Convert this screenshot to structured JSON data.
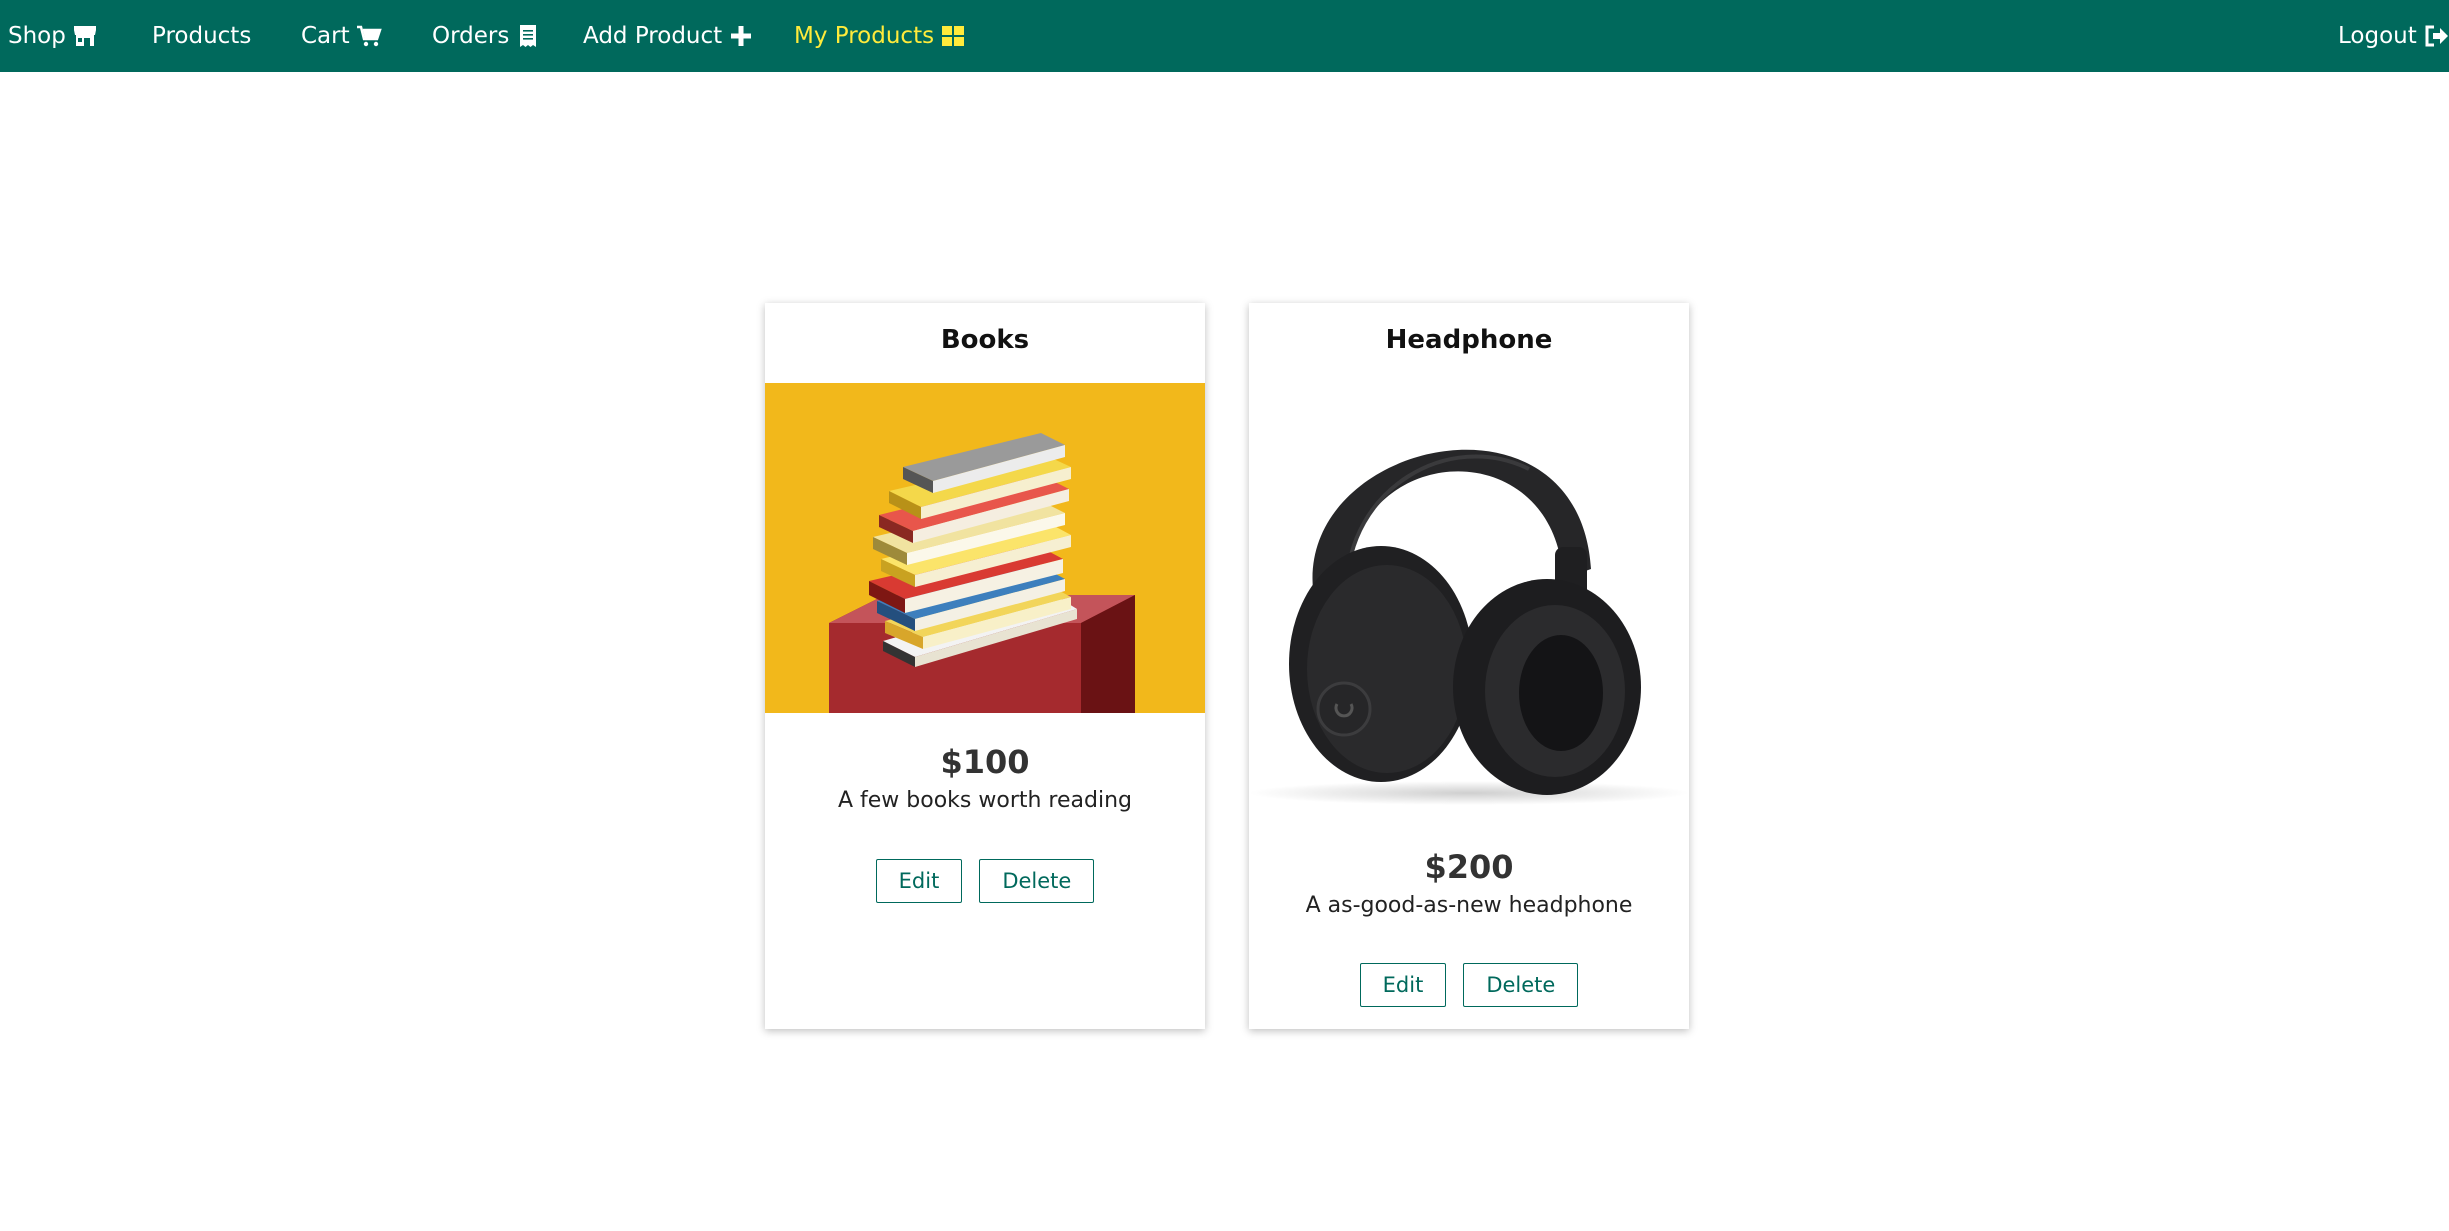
{
  "nav": {
    "shop": {
      "label": "Shop",
      "icon": "store-icon"
    },
    "products": {
      "label": "Products"
    },
    "cart": {
      "label": "Cart",
      "icon": "cart-icon"
    },
    "orders": {
      "label": "Orders",
      "icon": "receipt-icon"
    },
    "add_product": {
      "label": "Add Product",
      "icon": "plus-icon"
    },
    "my_products": {
      "label": "My Products",
      "icon": "grid-icon",
      "active": true
    },
    "logout": {
      "label": "Logout",
      "icon": "sign-out-icon"
    },
    "background": "#00695c",
    "active_color": "#ffeb3b"
  },
  "products": [
    {
      "title": "Books",
      "price": "$100",
      "description": "A few books worth reading",
      "image": "books-stack-image",
      "edit_label": "Edit",
      "delete_label": "Delete"
    },
    {
      "title": "Headphone",
      "price": "$200",
      "description": "A as-good-as-new headphone",
      "image": "headphone-image",
      "edit_label": "Edit",
      "delete_label": "Delete"
    }
  ],
  "accent": "#00695c"
}
